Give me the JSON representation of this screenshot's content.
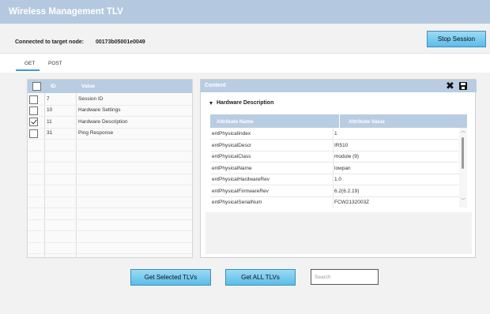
{
  "window": {
    "title": "Wireless Management TLV"
  },
  "connection": {
    "label": "Connected to target node:",
    "node_id": "00173b05001e0049"
  },
  "stop_button": {
    "label": "Stop Session"
  },
  "tabs": [
    {
      "label": "GET",
      "active": true
    },
    {
      "label": "POST",
      "active": false
    }
  ],
  "tlv_list": {
    "columns": {
      "id": "ID",
      "value": "Value"
    },
    "rows": [
      {
        "id": "7",
        "value": "Session ID",
        "checked": false
      },
      {
        "id": "10",
        "value": "Hardware Settings",
        "checked": false
      },
      {
        "id": "11",
        "value": "Hardware Description",
        "checked": true
      },
      {
        "id": "31",
        "value": "Ping Response",
        "checked": false
      }
    ]
  },
  "content": {
    "title": "Content",
    "section_title": "Hardware Description",
    "columns": {
      "name": "Attribute Name",
      "value": "Attribute Value"
    },
    "rows": [
      {
        "name": "entPhysicalIndex",
        "value": "1"
      },
      {
        "name": "entPhysicalDescr",
        "value": "IR510"
      },
      {
        "name": "entPhysicalClass",
        "value": "module (9)"
      },
      {
        "name": "entPhysicalName",
        "value": "lowpan"
      },
      {
        "name": "entPhysicalHardwareRev",
        "value": "1.0"
      },
      {
        "name": "entPhysicalFirmwareRev",
        "value": "6.2(6.2.19)"
      },
      {
        "name": "entPhysicalSerialNum",
        "value": "FCW2132003Z"
      }
    ],
    "icons": {
      "close": "close-icon",
      "save": "save-icon"
    }
  },
  "actions": {
    "get_selected_label": "Get Selected TLVs",
    "get_all_label": "Get ALL TLVs"
  },
  "search": {
    "placeholder": "Search",
    "value": ""
  },
  "colors": {
    "title_bar": "#b4c9df",
    "panel_header": "#b9cde2",
    "button": "#5cbde8",
    "tab_indicator": "#3a9bd5"
  }
}
